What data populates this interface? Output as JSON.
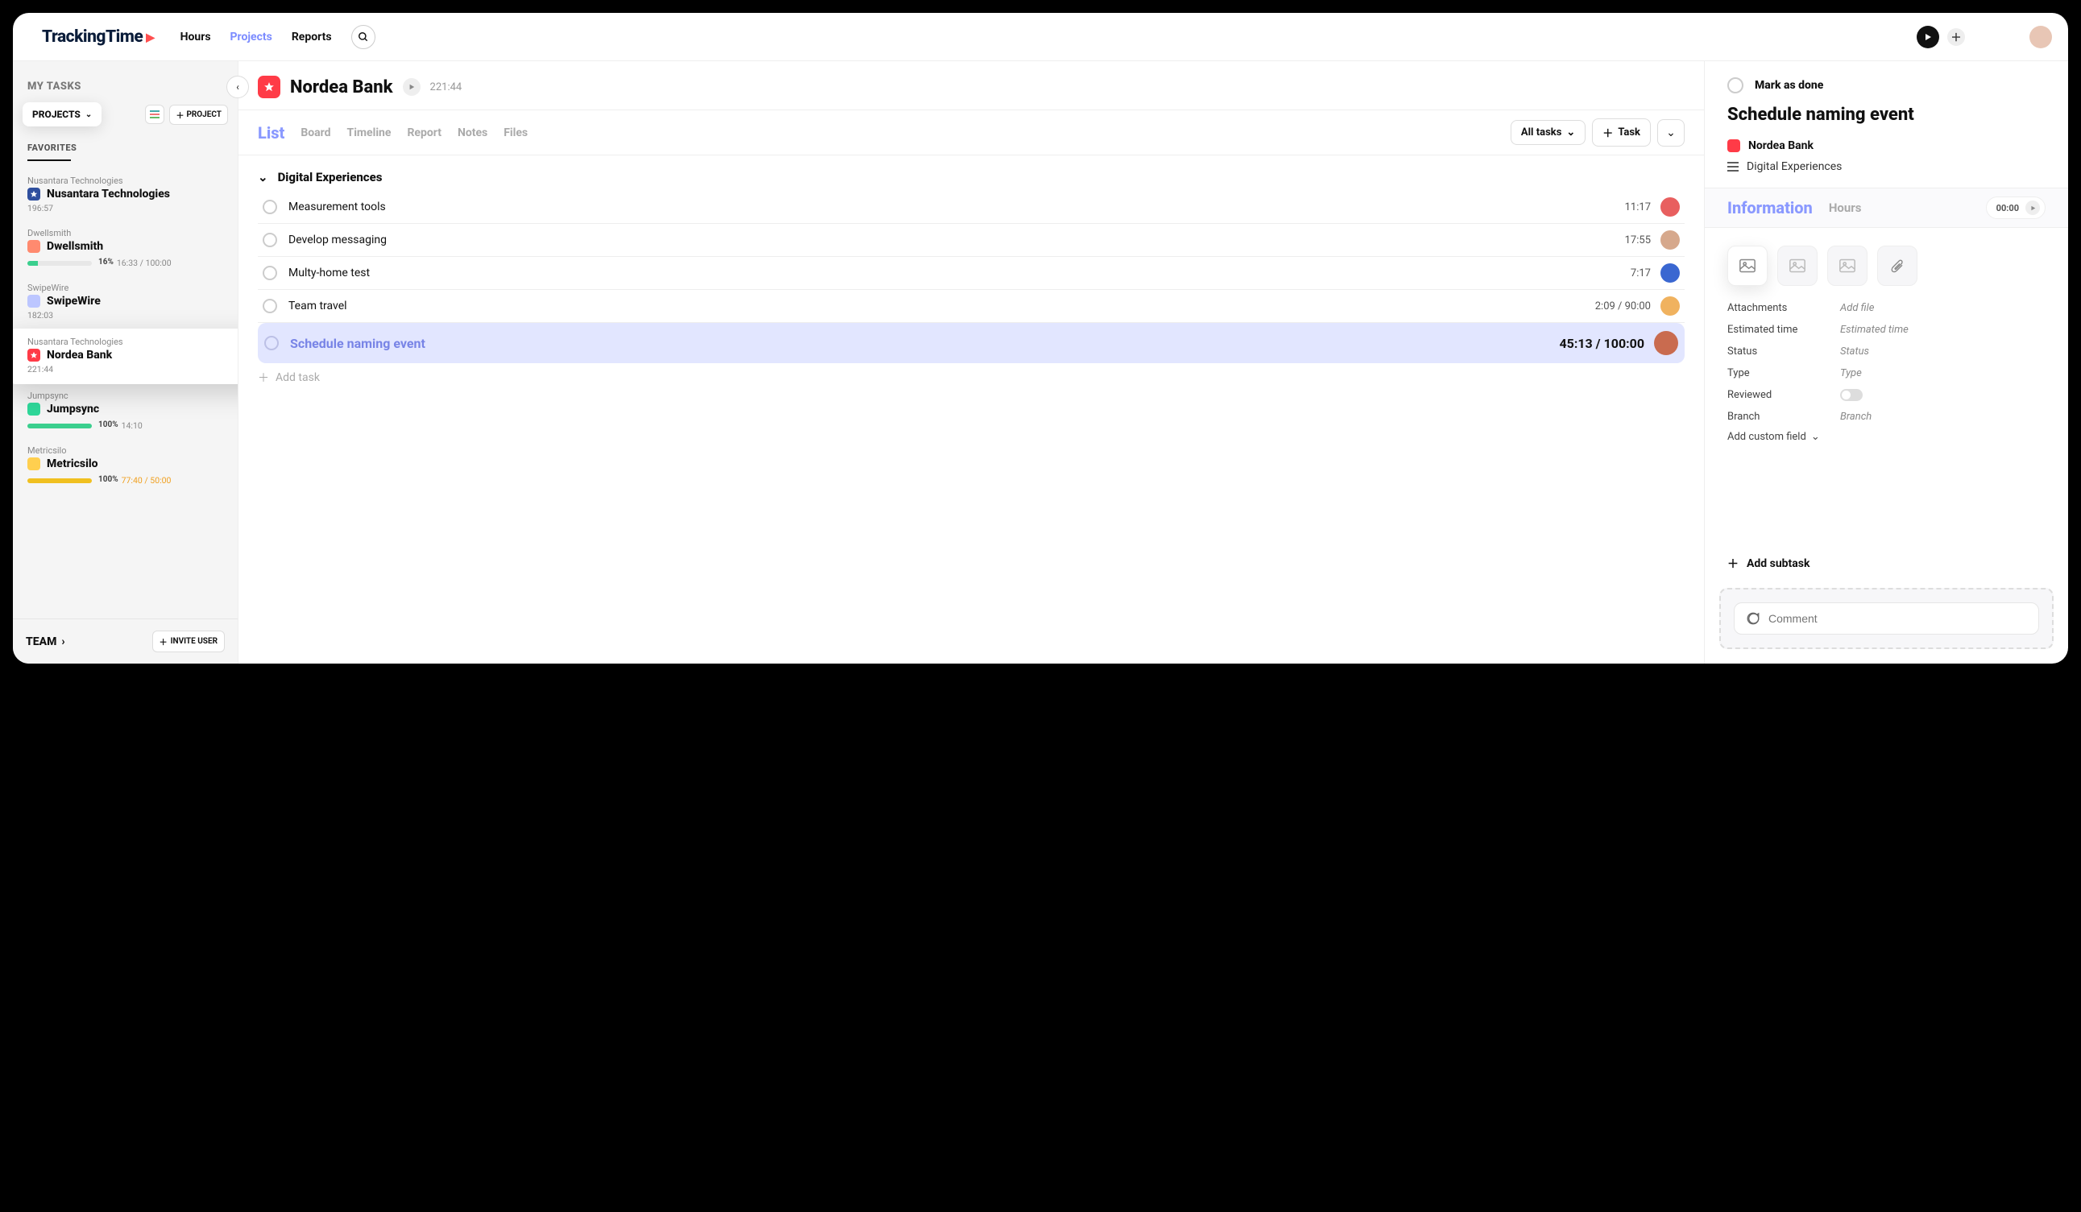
{
  "brand": {
    "name": "TrackingTime"
  },
  "nav": {
    "hours": "Hours",
    "projects": "Projects",
    "reports": "Reports",
    "active": "projects"
  },
  "sidebar": {
    "my_tasks": "MY TASKS",
    "projects_label": "PROJECTS",
    "add_project": "PROJECT",
    "favorites": "FAVORITES",
    "team": "TEAM",
    "invite": "INVITE USER",
    "items": [
      {
        "org": "Nusantara Technologies",
        "name": "Nusantara Technologies",
        "time": "196:57",
        "color": "#2f4f9e",
        "icon": "star"
      },
      {
        "org": "Dwellsmith",
        "name": "Dwellsmith",
        "time": "",
        "color": "#ff8a6f",
        "pct": "16%",
        "ratio": "16:33 / 100:00",
        "fill": 16
      },
      {
        "org": "SwipeWire",
        "name": "SwipeWire",
        "time": "182:03",
        "color": "#bcc6ff"
      },
      {
        "org": "Nusantara Technologies",
        "name": "Nordea Bank",
        "time": "221:44",
        "color": "#ff3b47",
        "icon": "star",
        "highlight": true
      },
      {
        "org": "Jumpsync",
        "name": "Jumpsync",
        "time": "",
        "color": "#2fd89a",
        "pct": "100%",
        "ratio": "14:10",
        "fill": 100
      },
      {
        "org": "Metricsilo",
        "name": "Metricsilo",
        "time": "",
        "color": "#ffcf4f",
        "pct": "100%",
        "ratio": "77:40 / 50:00",
        "ratioColor": "#f0a020",
        "fill": 100,
        "fillColor": "#f0c020"
      }
    ]
  },
  "project": {
    "name": "Nordea Bank",
    "time": "221:44",
    "section": "Digital Experiences",
    "tabs": {
      "list": "List",
      "board": "Board",
      "timeline": "Timeline",
      "report": "Report",
      "notes": "Notes",
      "files": "Files",
      "active": "list"
    },
    "filter": "All tasks",
    "add_task_btn": "Task",
    "add_task_inline": "Add task",
    "tasks": [
      {
        "name": "Measurement tools",
        "time": "11:17",
        "avatar": "#e85f5f"
      },
      {
        "name": "Develop messaging",
        "time": "17:55",
        "avatar": "#d6a88c"
      },
      {
        "name": "Multy-home test",
        "time": "7:17",
        "avatar": "#3a67d1"
      },
      {
        "name": "Team travel",
        "time": "2:09 / 90:00",
        "avatar": "#f0b25f"
      },
      {
        "name": "Schedule naming event",
        "time": "45:13 / 100:00",
        "avatar": "#c96b4f",
        "selected": true
      }
    ]
  },
  "details": {
    "mark_done": "Mark as done",
    "task_title": "Schedule naming event",
    "proj_name": "Nordea Bank",
    "section": "Digital Experiences",
    "info_tabs": {
      "information": "Information",
      "hours": "Hours",
      "active": "information"
    },
    "timer": "00:00",
    "fields": {
      "attachments": {
        "label": "Attachments",
        "placeholder": "Add file"
      },
      "estimated": {
        "label": "Estimated time",
        "placeholder": "Estimated time"
      },
      "status": {
        "label": "Status",
        "placeholder": "Status"
      },
      "type": {
        "label": "Type",
        "placeholder": "Type"
      },
      "reviewed": {
        "label": "Reviewed"
      },
      "branch": {
        "label": "Branch",
        "placeholder": "Branch"
      },
      "add_custom": "Add custom field"
    },
    "add_subtask": "Add subtask",
    "comment_placeholder": "Comment"
  }
}
